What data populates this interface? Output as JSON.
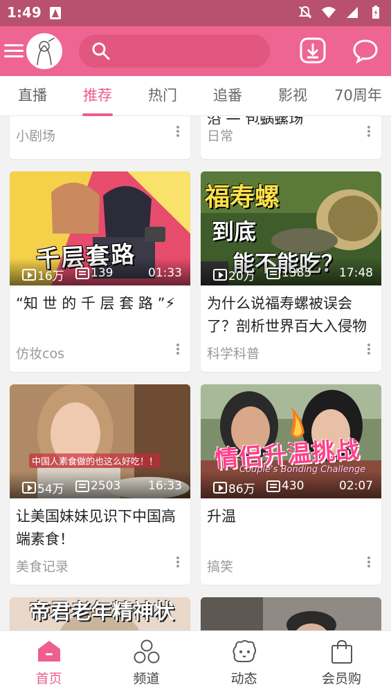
{
  "status_bar": {
    "time": "1:49"
  },
  "top_bar": {
    "search_placeholder": ""
  },
  "tabs": [
    {
      "label": "直播"
    },
    {
      "label": "推荐"
    },
    {
      "label": "热门"
    },
    {
      "label": "追番"
    },
    {
      "label": "影视"
    },
    {
      "label": "70周年"
    }
  ],
  "feed": {
    "partial_top": [
      {
        "title_fragment": "",
        "category": "小剧场"
      },
      {
        "title_fragment": "沿 一 包蜗螺场",
        "category": "日常"
      }
    ],
    "cards": [
      {
        "views": "16万",
        "danmaku": "139",
        "duration": "01:33",
        "title": "“知 世 的 千 层 套 路 ”⚡",
        "category": "仿妆cos",
        "thumb_text": "千层套路"
      },
      {
        "views": "20万",
        "danmaku": "1385",
        "duration": "17:48",
        "title": "为什么说福寿螺被误会了？剖析世界百大入侵物",
        "category": "科学科普",
        "thumb_text_1": "福寿螺",
        "thumb_text_2": "到底",
        "thumb_text_3": "能不能吃？"
      },
      {
        "views": "54万",
        "danmaku": "2503",
        "duration": "16:33",
        "title": "让美国妹妹见识下中国高端素食！",
        "category": "美食记录",
        "thumb_text": "中国人素食做的也这么好吃！！"
      },
      {
        "views": "86万",
        "danmaku": "430",
        "duration": "02:07",
        "title": "升温",
        "category": "搞笑",
        "thumb_text_1": "情侣升温挑战",
        "thumb_text_2": "Couple's Bonding Challenge"
      }
    ],
    "partial_bottom": [
      {
        "thumb_text": "帝君老年精神状态"
      },
      {
        "thumb_text": ""
      }
    ]
  },
  "bottom_nav": [
    {
      "label": "首页"
    },
    {
      "label": "频道"
    },
    {
      "label": "动态"
    },
    {
      "label": "会员购"
    }
  ],
  "colors": {
    "accent": "#ee5f8e",
    "topbar": "#ee6593",
    "statusbar": "#b8506f"
  }
}
